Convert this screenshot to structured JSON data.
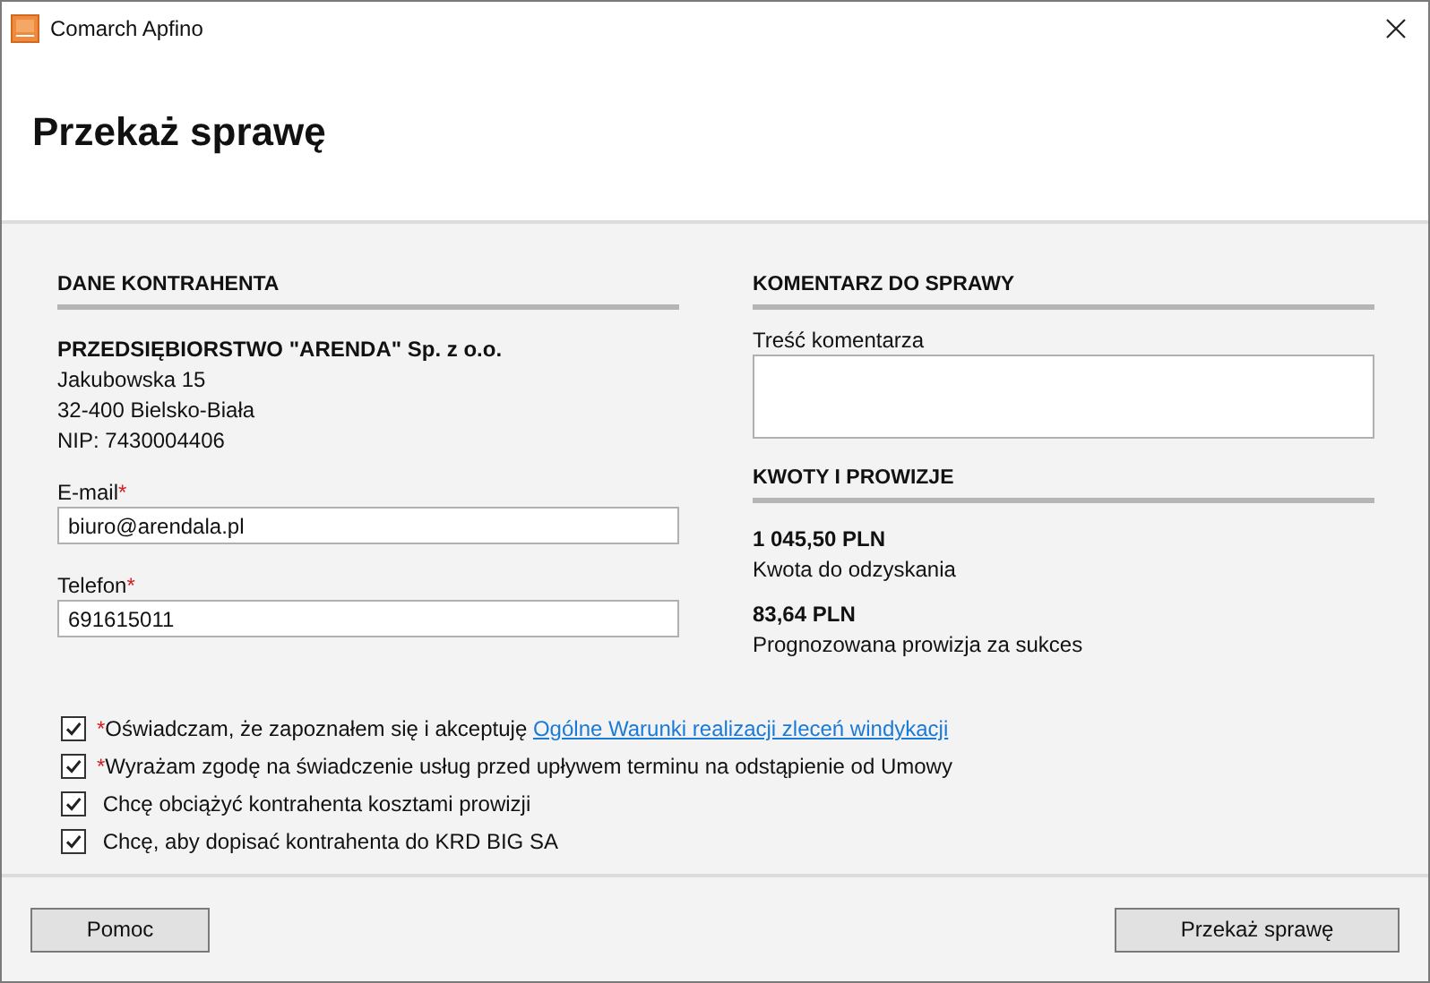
{
  "window": {
    "title": "Comarch Apfino"
  },
  "page_title": "Przekaż sprawę",
  "contractor": {
    "heading": "DANE KONTRAHENTA",
    "name": "PRZEDSIĘBIORSTWO \"ARENDA\" Sp. z o.o.",
    "address": [
      "Jakubowska 15",
      "32-400 Bielsko-Biała",
      "NIP: 7430004406"
    ],
    "fields": [
      {
        "label": "E-mail",
        "mark": "*",
        "value": "biuro@arendala.pl"
      },
      {
        "label": "Telefon",
        "mark": "*",
        "value": "691615011"
      }
    ]
  },
  "comment": {
    "heading": "KOMENTARZ DO SPRAWY",
    "label": "Treść komentarza"
  },
  "amounts": {
    "heading": "KWOTY I PROWIZJE",
    "items": [
      {
        "value": "1 045,50 PLN",
        "caption": "Kwota do odzyskania"
      },
      {
        "value": "83,64 PLN",
        "caption": "Prognozowana prowizja za sukces"
      }
    ]
  },
  "consents": [
    {
      "checked": true,
      "mark": "*",
      "text": "Oświadczam, że zapoznałem się i akceptuję",
      "link": "Ogólne Warunki realizacji zleceń windykacji"
    },
    {
      "checked": true,
      "mark": "*",
      "text": "Wyrażam zgodę na świadczenie usług przed upływem terminu na odstąpienie od Umowy"
    },
    {
      "checked": true,
      "text": "Chcę obciążyć kontrahenta kosztami prowizji"
    },
    {
      "checked": true,
      "text": "Chcę, aby dopisać kontrahenta do KRD BIG SA"
    }
  ],
  "buttons": {
    "help": "Pomoc",
    "submit": "Przekaż sprawę"
  }
}
